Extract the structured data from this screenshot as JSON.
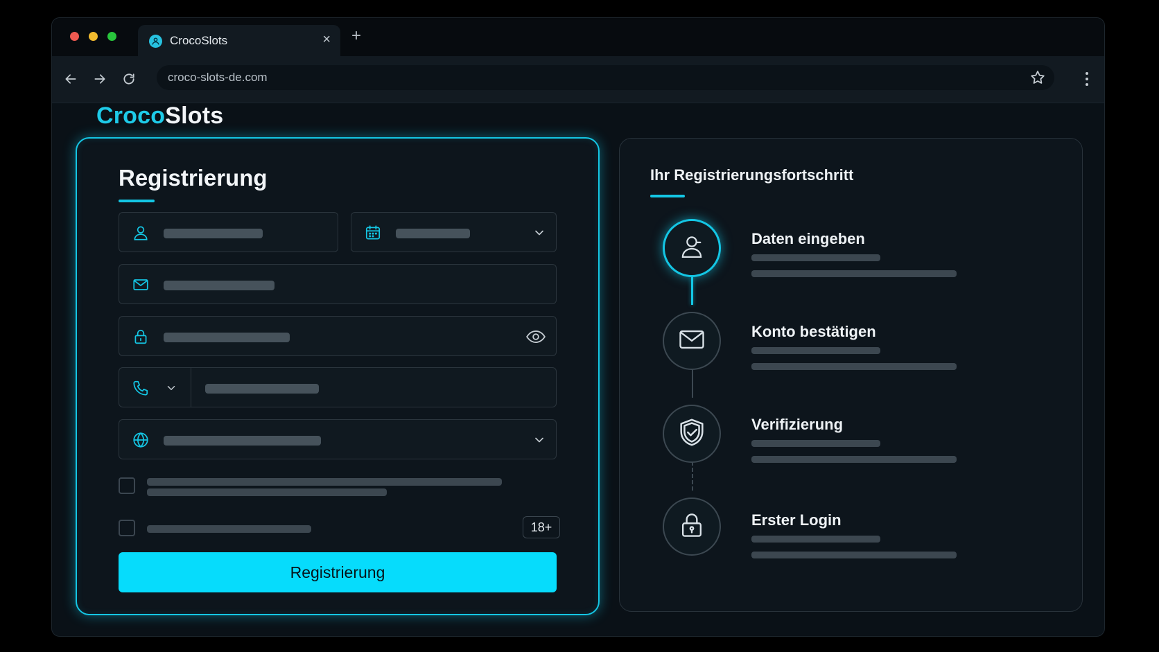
{
  "browser": {
    "tab_title": "CrocoSlots",
    "tab_close": "×",
    "new_tab": "+",
    "url": "croco-slots-de.com"
  },
  "brand": {
    "part1": "Croco",
    "part2": "Slots",
    "accent_color": "#14c6e4"
  },
  "registration": {
    "title": "Registrierung",
    "age_badge": "18+",
    "submit_label": "Registrierung",
    "fields": [
      {
        "icon": "user-icon"
      },
      {
        "icon": "calendar-icon"
      },
      {
        "icon": "mail-icon"
      },
      {
        "icon": "lock-icon"
      },
      {
        "icon": "phone-icon"
      },
      {
        "icon": "globe-icon"
      }
    ]
  },
  "progress": {
    "title": "Ihr Registrierungsfortschritt",
    "steps": [
      {
        "label": "Daten eingeben",
        "icon": "user-icon",
        "active": true
      },
      {
        "label": "Konto bestätigen",
        "icon": "mail-icon",
        "active": false
      },
      {
        "label": "Verifizierung",
        "icon": "shield-check-icon",
        "active": false
      },
      {
        "label": "Erster Login",
        "icon": "padlock-icon",
        "active": false
      }
    ]
  }
}
